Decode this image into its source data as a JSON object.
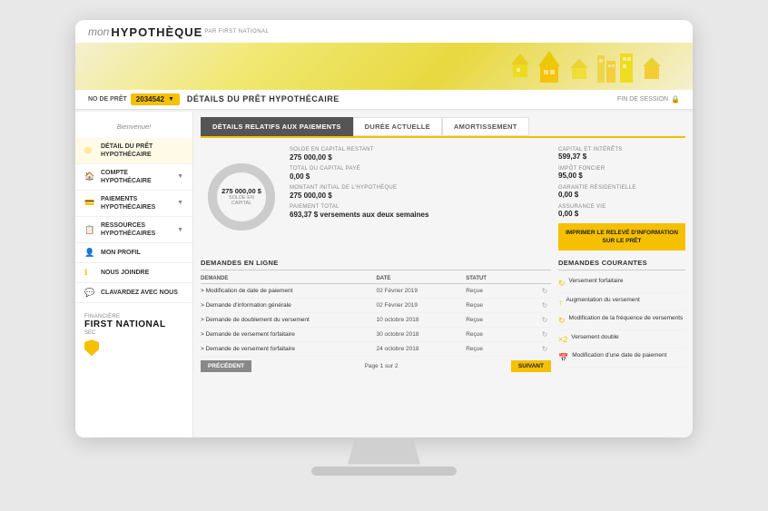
{
  "app": {
    "title": "Mon Hypothèque"
  },
  "header": {
    "logo_mon": "mon",
    "logo_hypotheque": "HYPOTHÈQUE",
    "logo_tm": "™",
    "logo_by": "PAR FIRST NATIONAL"
  },
  "nav": {
    "loan_label": "NO DE PRÊT",
    "loan_value": "2034542",
    "page_title": "DÉTAILS DU PRÊT HYPOTHÉCAIRE",
    "session_end": "FIN DE SESSION",
    "lock_icon": "🔒"
  },
  "sidebar": {
    "welcome": "Bienvenue!",
    "items": [
      {
        "id": "detail-pret",
        "label": "DÉTAIL DU PRÊT HYPOTHÉCAIRE",
        "icon": "◎",
        "has_arrow": false
      },
      {
        "id": "compte-hypothecaire",
        "label": "COMPTE HYPOTHÉCAIRE",
        "icon": "🏠",
        "has_arrow": true
      },
      {
        "id": "paiements-hypothecaires",
        "label": "PAIEMENTS HYPOTHÉCAIRES",
        "icon": "💳",
        "has_arrow": true
      },
      {
        "id": "ressources-hypothecaires",
        "label": "RESSOURCES HYPOTHÉCAIRES",
        "icon": "📋",
        "has_arrow": true
      },
      {
        "id": "mon-profil",
        "label": "MON PROFIL",
        "icon": "👤",
        "has_arrow": false
      },
      {
        "id": "nous-joindre",
        "label": "NOUS JOINDRE",
        "icon": "ℹ",
        "has_arrow": false
      },
      {
        "id": "clavardez",
        "label": "CLAVARDEZ AVEC NOUS",
        "icon": "💬",
        "has_arrow": false
      }
    ],
    "brand": {
      "financiere": "FINANCIÈRE",
      "first_national": "FIRST NATIONAL",
      "sec": "SEC"
    }
  },
  "tabs": [
    {
      "id": "details-paiements",
      "label": "DÉTAILS RELATIFS AUX PAIEMENTS",
      "active": true
    },
    {
      "id": "duree-actuelle",
      "label": "DURÉE ACTUELLE",
      "active": false
    },
    {
      "id": "amortissement",
      "label": "AMORTISSEMENT",
      "active": false
    }
  ],
  "payment_info": {
    "donut": {
      "amount": "275 000,00 $",
      "label": "SOLDE EN CAPITAL"
    },
    "solde_capital_restant_label": "SOLDE EN CAPITAL RESTANT",
    "solde_capital_restant_value": "275 000,00 $",
    "total_capital_paye_label": "TOTAL DU CAPITAL PAYÉ",
    "total_capital_paye_value": "0,00 $",
    "montant_initial_label": "MONTANT INITIAL DE L'HYPOTHÈQUE",
    "montant_initial_value": "275 000,00 $",
    "paiement_total_label": "PAIEMENT TOTAL",
    "paiement_total_value": "693,37 $ versements aux deux semaines"
  },
  "right_info": {
    "capital_interets_label": "CAPITAL ET INTÉRÊTS",
    "capital_interets_value": "599,37 $",
    "impot_foncier_label": "IMPÔT FONCIER",
    "impot_foncier_value": "95,00 $",
    "garantie_label": "GARANTIE RÉSIDENTIELLE",
    "garantie_value": "0,00 $",
    "assurance_label": "ASSURANCE VIE",
    "assurance_value": "0,00 $",
    "print_button": "IMPRIMER LE RELEVÉ D'INFORMATION SUR LE PRÊT"
  },
  "demandes_en_ligne": {
    "title": "DEMANDES EN LIGNE",
    "columns": {
      "demande": "DEMANDE",
      "date": "DATE",
      "statut": "STATUT"
    },
    "rows": [
      {
        "demande": "> Modification de date de paiement",
        "date": "02 Février 2019",
        "statut": "Reçue"
      },
      {
        "demande": "> Demande d'information générale",
        "date": "02 Février 2019",
        "statut": "Reçue"
      },
      {
        "demande": "> Demande de doublement du versement",
        "date": "10 octobre 2018",
        "statut": "Reçue"
      },
      {
        "demande": "> Demande de versement forfaitaire",
        "date": "30 octobre 2018",
        "statut": "Reçue"
      },
      {
        "demande": "> Demande de versement forfaitaire",
        "date": "24 octobre 2018",
        "statut": "Reçue"
      }
    ],
    "pagination": {
      "prev": "PRÉCÉDENT",
      "page_info": "Page 1 sur 2",
      "next": "SUIVANT"
    }
  },
  "demandes_courantes": {
    "title": "DEMANDES COURANTES",
    "items": [
      {
        "icon": "↻",
        "label": "Versement forfaitaire"
      },
      {
        "icon": "↑",
        "label": "Augmentation du versement"
      },
      {
        "icon": "↻",
        "label": "Modification de la fréquence de versements"
      },
      {
        "icon": "×2",
        "label": "Versement double"
      },
      {
        "icon": "📅",
        "label": "Modification d'une date de paiement"
      }
    ]
  }
}
